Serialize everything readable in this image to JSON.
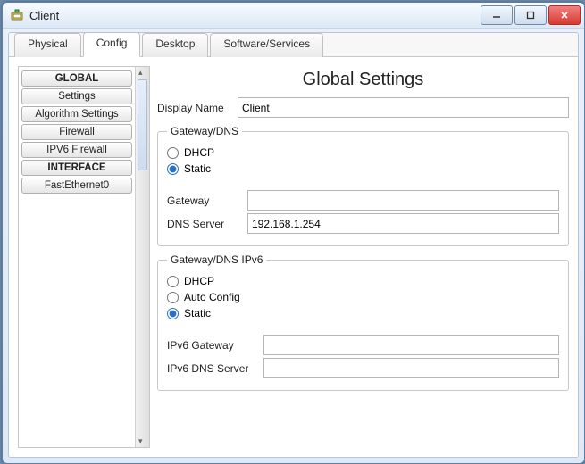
{
  "window": {
    "title": "Client",
    "minimize_tip": "Minimize",
    "maximize_tip": "Maximize",
    "close_tip": "Close"
  },
  "tabs": {
    "physical": "Physical",
    "config": "Config",
    "desktop": "Desktop",
    "software": "Software/Services",
    "active": "config"
  },
  "sidebar": {
    "global_header": "GLOBAL",
    "settings": "Settings",
    "algorithm_settings": "Algorithm Settings",
    "firewall": "Firewall",
    "ipv6_firewall": "IPV6 Firewall",
    "interface_header": "INTERFACE",
    "fastethernet0": "FastEthernet0"
  },
  "panel": {
    "title": "Global Settings",
    "display_name_label": "Display Name",
    "display_name_value": "Client",
    "gateway_dns": {
      "legend": "Gateway/DNS",
      "dhcp": "DHCP",
      "static": "Static",
      "selected": "static",
      "gateway_label": "Gateway",
      "gateway_value": "",
      "dns_label": "DNS Server",
      "dns_value": "192.168.1.254"
    },
    "gateway_dns_v6": {
      "legend": "Gateway/DNS IPv6",
      "dhcp": "DHCP",
      "auto": "Auto Config",
      "static": "Static",
      "selected": "static",
      "gateway_label": "IPv6 Gateway",
      "gateway_value": "",
      "dns_label": "IPv6 DNS Server",
      "dns_value": ""
    }
  }
}
